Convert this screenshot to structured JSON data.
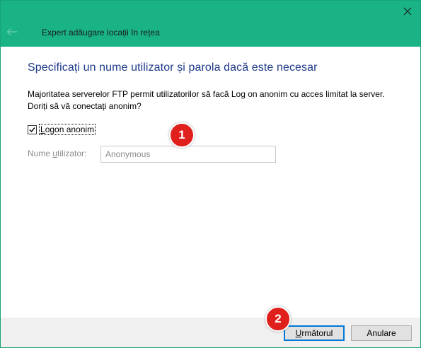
{
  "window": {
    "title": "Expert adăugare locații în rețea"
  },
  "page": {
    "heading": "Specificați un nume utilizator și parola dacă este necesar",
    "description_line1": "Majoritatea serverelor FTP permit utilizatorilor să facă Log on anonim cu acces limitat la server.",
    "description_line2": "Doriți să vă conectați anonim?"
  },
  "anonymous_logon": {
    "label_pre": "",
    "label_underlined": "L",
    "label_post": "ogon anonim",
    "checked": true
  },
  "username": {
    "label_pre": "Nume ",
    "label_underlined": "u",
    "label_post": "tilizator:",
    "value": "Anonymous",
    "enabled": false
  },
  "buttons": {
    "next_pre": "",
    "next_underlined": "U",
    "next_post": "rmătorul",
    "cancel": "Anulare"
  },
  "annotations": {
    "badge1": "1",
    "badge2": "2"
  },
  "colors": {
    "titlebar": "#1ab385",
    "heading": "#1e3a8a",
    "badge": "#e0201c",
    "focus_border": "#0078d7"
  },
  "icons": {
    "close": "close-icon",
    "back": "back-arrow-icon",
    "checkmark": "checkmark-icon"
  }
}
